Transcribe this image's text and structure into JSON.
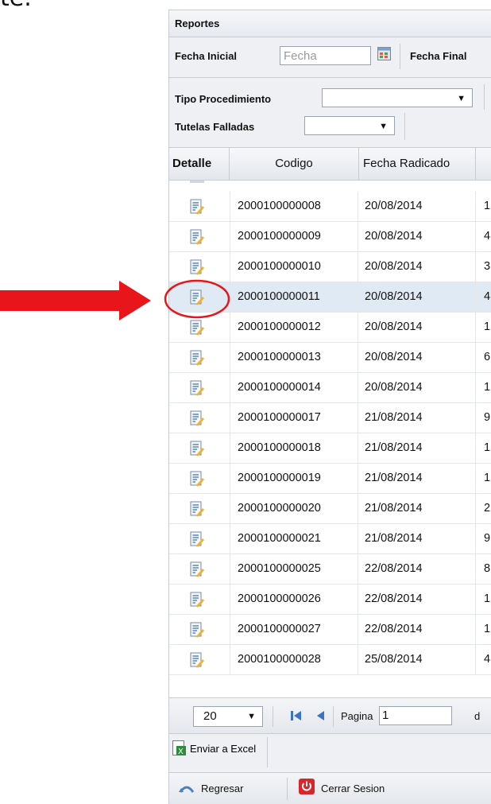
{
  "fragment_text": "te.",
  "panel": {
    "title": "Reportes",
    "filters": {
      "fecha_inicial_label": "Fecha Inicial",
      "fecha_inicial_placeholder": "Fecha",
      "fecha_final_label": "Fecha Final",
      "tipo_procedimiento_label": "Tipo Procedimiento",
      "tutelas_falladas_label": "Tutelas Falladas"
    },
    "grid": {
      "columns": [
        "Detalle",
        "Codigo",
        "Fecha Radicado"
      ],
      "rows": [
        {
          "codigo": "2000100000008",
          "fecha": "20/08/2014",
          "extra": "1"
        },
        {
          "codigo": "2000100000009",
          "fecha": "20/08/2014",
          "extra": "4"
        },
        {
          "codigo": "2000100000010",
          "fecha": "20/08/2014",
          "extra": "3"
        },
        {
          "codigo": "2000100000011",
          "fecha": "20/08/2014",
          "extra": "4"
        },
        {
          "codigo": "2000100000012",
          "fecha": "20/08/2014",
          "extra": "1"
        },
        {
          "codigo": "2000100000013",
          "fecha": "20/08/2014",
          "extra": "6"
        },
        {
          "codigo": "2000100000014",
          "fecha": "20/08/2014",
          "extra": "1"
        },
        {
          "codigo": "2000100000017",
          "fecha": "21/08/2014",
          "extra": "9"
        },
        {
          "codigo": "2000100000018",
          "fecha": "21/08/2014",
          "extra": "1"
        },
        {
          "codigo": "2000100000019",
          "fecha": "21/08/2014",
          "extra": "1"
        },
        {
          "codigo": "2000100000020",
          "fecha": "21/08/2014",
          "extra": "2"
        },
        {
          "codigo": "2000100000021",
          "fecha": "21/08/2014",
          "extra": "9"
        },
        {
          "codigo": "2000100000025",
          "fecha": "22/08/2014",
          "extra": "8"
        },
        {
          "codigo": "2000100000026",
          "fecha": "22/08/2014",
          "extra": "1"
        },
        {
          "codigo": "2000100000027",
          "fecha": "22/08/2014",
          "extra": "1"
        },
        {
          "codigo": "2000100000028",
          "fecha": "25/08/2014",
          "extra": "4"
        }
      ]
    },
    "pager": {
      "page_size": "20",
      "page_label": "Pagina",
      "page_value": "1",
      "trailing_text": "d"
    },
    "export_label": "Enviar a Excel",
    "back_label": "Regresar",
    "logout_label": "Cerrar Sesion"
  },
  "colors": {
    "annotation": "#e8161b",
    "selected_row": "#dfeaf5",
    "detail_icon_accent": "#f3b12b"
  },
  "icons": {
    "calendar": "calendar-icon",
    "detail": "document-edit-icon",
    "first_page": "first-page-icon",
    "prev_page": "previous-page-icon",
    "excel": "excel-icon",
    "back": "back-icon",
    "power": "power-icon"
  }
}
